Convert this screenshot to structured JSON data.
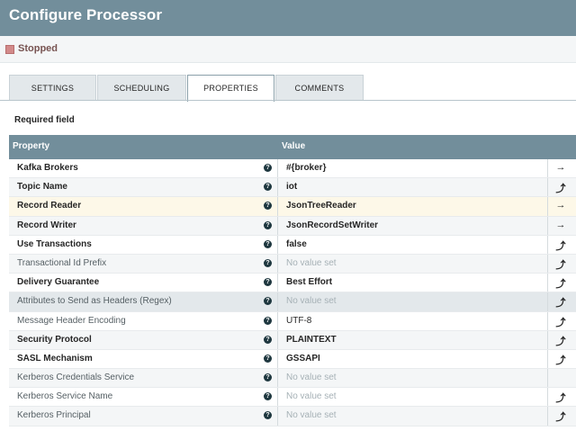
{
  "dialog": {
    "title": "Configure Processor",
    "status": "Stopped",
    "status_color": "#d28a8a"
  },
  "tabs": [
    {
      "label": "SETTINGS"
    },
    {
      "label": "SCHEDULING"
    },
    {
      "label": "PROPERTIES",
      "active": true
    },
    {
      "label": "COMMENTS"
    }
  ],
  "required_label": "Required field",
  "table": {
    "header_property": "Property",
    "header_value": "Value",
    "rows": [
      {
        "name": "Kafka Brokers",
        "required": true,
        "value": "#{broker}",
        "action": "→",
        "action_icon": "go-to-arrow-icon"
      },
      {
        "name": "Topic Name",
        "required": true,
        "value": "iot",
        "action": "⤴",
        "action_icon": "convert-to-parameter-icon"
      },
      {
        "name": "Record Reader",
        "required": true,
        "value": "JsonTreeReader",
        "action": "→",
        "action_icon": "go-to-arrow-icon"
      },
      {
        "name": "Record Writer",
        "required": true,
        "value": "JsonRecordSetWriter",
        "action": "→",
        "action_icon": "go-to-arrow-icon"
      },
      {
        "name": "Use Transactions",
        "required": true,
        "value": "false",
        "action": "⤴",
        "action_icon": "convert-to-parameter-icon"
      },
      {
        "name": "Transactional Id Prefix",
        "required": false,
        "value": "No value set",
        "action": "⤴",
        "action_icon": "convert-to-parameter-icon"
      },
      {
        "name": "Delivery Guarantee",
        "required": true,
        "value": "Best Effort",
        "action": "⤴",
        "action_icon": "convert-to-parameter-icon"
      },
      {
        "name": "Attributes to Send as Headers (Regex)",
        "required": false,
        "value": "No value set",
        "action": "⤴",
        "action_icon": "convert-to-parameter-icon"
      },
      {
        "name": "Message Header Encoding",
        "required": false,
        "value": "UTF-8",
        "action": "⤴",
        "action_icon": "convert-to-parameter-icon"
      },
      {
        "name": "Security Protocol",
        "required": true,
        "value": "PLAINTEXT",
        "action": "⤴",
        "action_icon": "convert-to-parameter-icon"
      },
      {
        "name": "SASL Mechanism",
        "required": true,
        "value": "GSSAPI",
        "action": "⤴",
        "action_icon": "convert-to-parameter-icon"
      },
      {
        "name": "Kerberos Credentials Service",
        "required": false,
        "value": "No value set",
        "action": "",
        "action_icon": ""
      },
      {
        "name": "Kerberos Service Name",
        "required": false,
        "value": "No value set",
        "action": "⤴",
        "action_icon": "convert-to-parameter-icon"
      },
      {
        "name": "Kerberos Principal",
        "required": false,
        "value": "No value set",
        "action": "⤴",
        "action_icon": "convert-to-parameter-icon"
      }
    ]
  },
  "colors": {
    "header_bg": "#728e9b",
    "highlight_row": "#fdf8e8",
    "selected_row": "#e3e8eb"
  }
}
